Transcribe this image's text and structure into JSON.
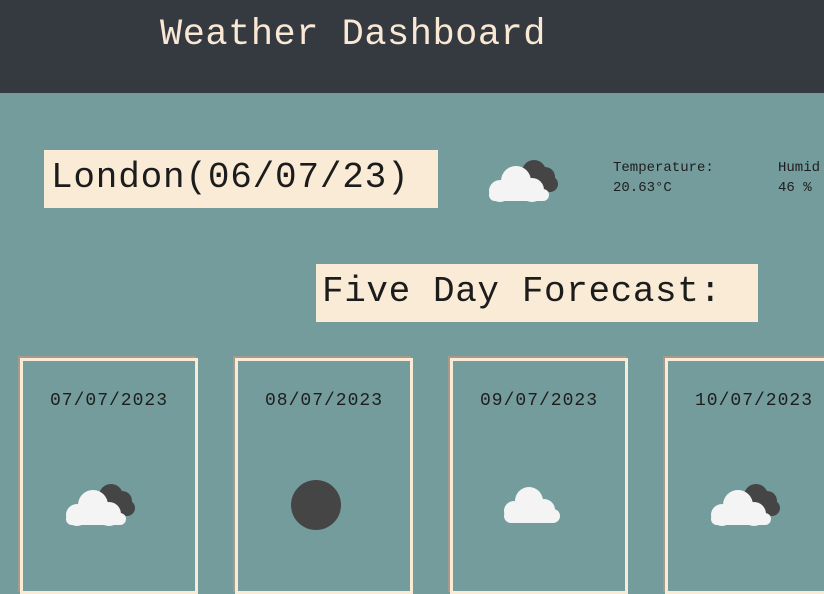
{
  "header": {
    "title": "Weather Dashboard"
  },
  "current": {
    "city_title": "London(06/07/23)",
    "icon": "cloudy-icon",
    "temperature_label": "Temperature:",
    "temperature_value": "20.63°C",
    "humidity_label": "Humid",
    "humidity_value": "46 %"
  },
  "forecast": {
    "heading": "Five Day Forecast:",
    "days": [
      {
        "date": "07/07/2023",
        "icon": "cloudy-icon"
      },
      {
        "date": "08/07/2023",
        "icon": "sun-icon"
      },
      {
        "date": "09/07/2023",
        "icon": "cloud-icon"
      },
      {
        "date": "10/07/2023",
        "icon": "cloudy-icon"
      }
    ]
  },
  "colors": {
    "background": "#749c9c",
    "header_bg": "#343a40",
    "header_text": "#f9e8d4",
    "box_bg": "#faebd7",
    "cloud_light": "#f4f4f4",
    "cloud_dark": "#454545"
  }
}
